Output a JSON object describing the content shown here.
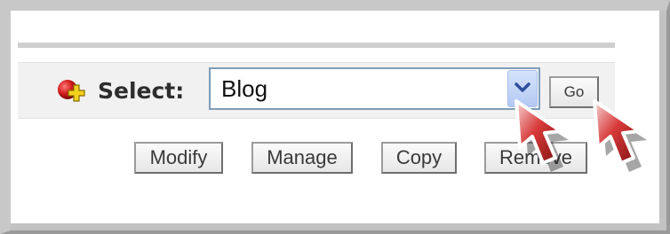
{
  "selector": {
    "label": "Select:",
    "value": "Blog",
    "icon": "add-icon",
    "dropdown_icon": "chevron-down-icon"
  },
  "go_button": {
    "label": "Go"
  },
  "actions": {
    "modify_label": "Modify",
    "manage_label": "Manage",
    "copy_label": "Copy",
    "remove_label": "Remove"
  },
  "colors": {
    "icon_red": "#cc1a1a",
    "icon_yellow": "#f2d21c",
    "dropdown_blue": "#2f4f9b",
    "cursor_red": "#cf2b2b"
  }
}
